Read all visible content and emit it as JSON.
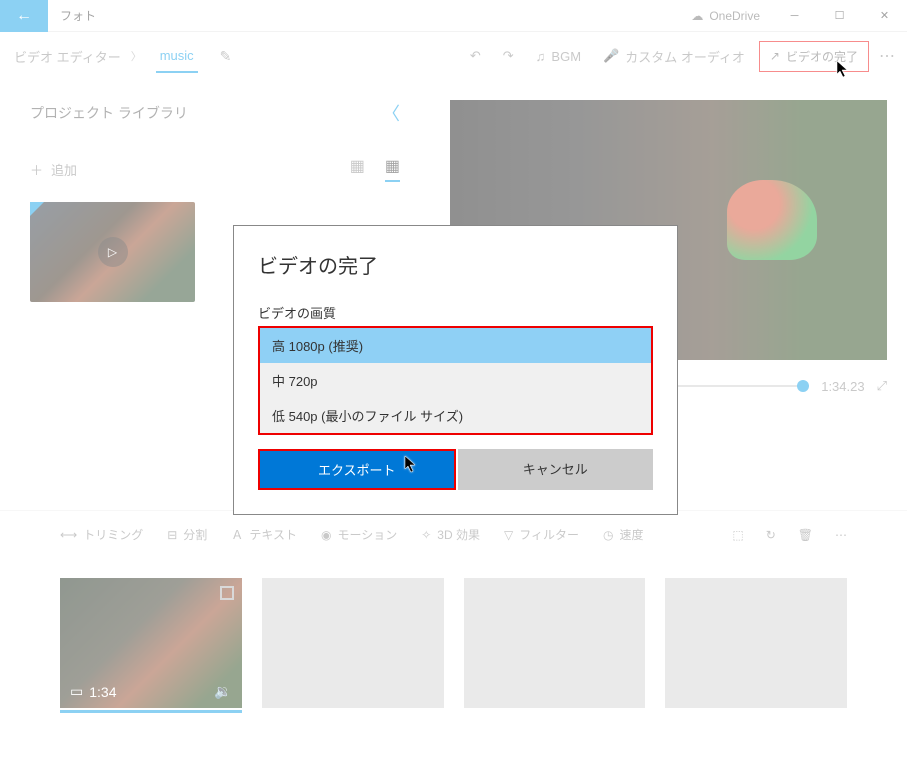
{
  "titlebar": {
    "app_name": "フォト",
    "onedrive": "OneDrive"
  },
  "toolbar": {
    "crumb1": "ビデオ エディター",
    "crumb2": "music",
    "undo": "↶",
    "redo": "↷",
    "bgm": "BGM",
    "custom_audio": "カスタム オーディオ",
    "finish": "ビデオの完了",
    "more": "⋯"
  },
  "sidebar": {
    "title": "プロジェクト ライブラリ",
    "add": "追加"
  },
  "preview": {
    "duration": "1:34.23"
  },
  "editbar": {
    "trim": "トリミング",
    "split": "分割",
    "text": "テキスト",
    "motion": "モーション",
    "fx3d": "3D 効果",
    "filter": "フィルター",
    "speed": "速度"
  },
  "storyboard": {
    "clip_duration": "1:34"
  },
  "dialog": {
    "title": "ビデオの完了",
    "quality_label": "ビデオの画質",
    "q_high": "高 1080p (推奨)",
    "q_mid": "中 720p",
    "q_low": "低 540p (最小のファイル サイズ)",
    "export": "エクスポート",
    "cancel": "キャンセル"
  }
}
